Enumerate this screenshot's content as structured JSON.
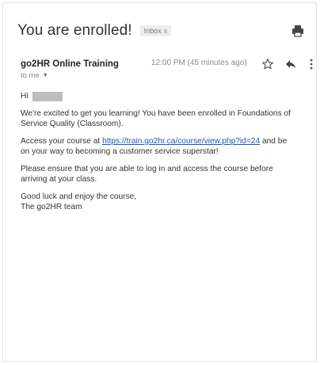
{
  "email": {
    "subject": "You are enrolled!",
    "label": "Inbox",
    "label_close": "x",
    "sender": "go2HR Online Training",
    "timestamp": "12:00 PM (45 minutes ago)",
    "recipient": "to me",
    "greeting": "Hi",
    "para1": "We're excited to get you learning! You have been enrolled in Foundations of Service Quality (Classroom).",
    "para2_before": "Access your course at ",
    "para2_link": "https://train.go2hr.ca/course/view.php?id=24",
    "para2_after": " and be on your way to becoming a customer service superstar!",
    "para3": "Please ensure that you are able to log in and access the course before arriving at your class.",
    "signoff_line1": "Good luck and enjoy the course,",
    "signoff_line2": "The go2HR team"
  },
  "icons": [
    "print-icon",
    "star-icon",
    "reply-icon",
    "more-vertical-icon",
    "chevron-down-icon"
  ],
  "colors": {
    "link": "#1a55c9",
    "redaction": "#bdbdbd"
  }
}
